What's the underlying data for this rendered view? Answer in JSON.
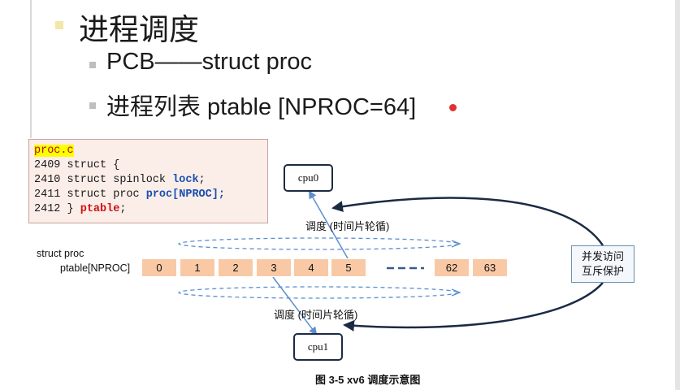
{
  "slide": {
    "title": "进程调度",
    "bullets": [
      "PCB——struct proc",
      "进程列表 ptable  [NPROC=64]"
    ]
  },
  "code": {
    "file": "proc.c",
    "lines": [
      {
        "num": "2409",
        "text": " struct {"
      },
      {
        "num": "2410",
        "text": " struct spinlock ",
        "kw": "lock",
        "tail": ";"
      },
      {
        "num": "2411",
        "text": " struct proc ",
        "kw": "proc[NPROC];"
      },
      {
        "num": "2412",
        "text": " } ",
        "red": "ptable",
        "tail": ";"
      }
    ]
  },
  "diagram": {
    "cpu0": "cpu0",
    "cpu1": "cpu1",
    "schedule_top": "调度  (时间片轮循)",
    "schedule_bottom": "调度  (时间片轮循)",
    "struct_label_1": "struct proc",
    "struct_label_2": "ptable[NPROC]",
    "cells": [
      "0",
      "1",
      "2",
      "3",
      "4",
      "5",
      "62",
      "63"
    ],
    "side_line_1": "并发访问",
    "side_line_2": "互斥保护",
    "caption": "图  3-5 xv6 调度示意图"
  },
  "colors": {
    "cell": "#f9c9a5",
    "arrow": "#5b8fd0",
    "curve": "#1c2a44"
  }
}
